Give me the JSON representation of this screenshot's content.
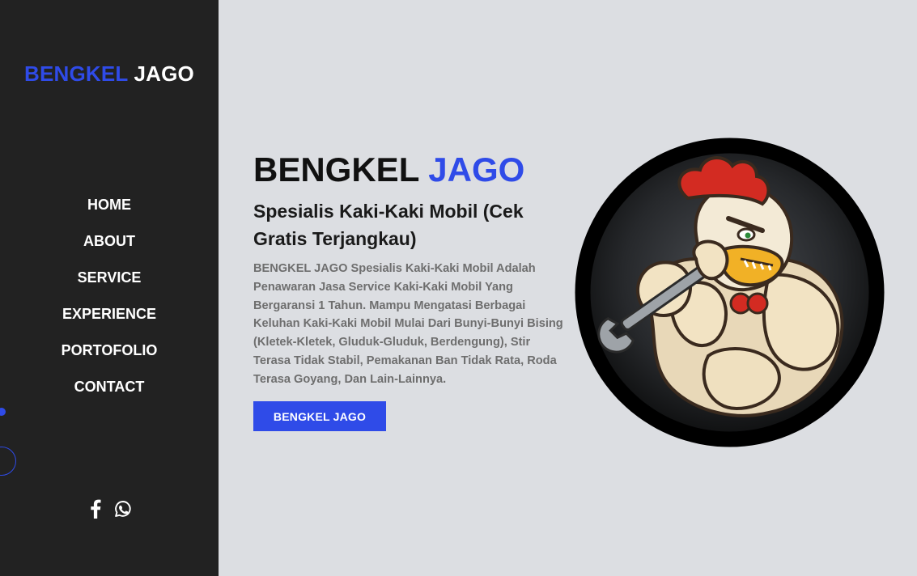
{
  "sidebar": {
    "logo": {
      "part1": "BENGKEL",
      "part2": "JAGO"
    },
    "nav": [
      {
        "label": "HOME"
      },
      {
        "label": "ABOUT"
      },
      {
        "label": "SERVICE"
      },
      {
        "label": "EXPERIENCE"
      },
      {
        "label": "PORTOFOLIO"
      },
      {
        "label": "CONTACT"
      }
    ],
    "social": [
      "facebook-icon",
      "whatsapp-icon"
    ]
  },
  "hero": {
    "title_part1": "BENGKEL",
    "title_part2": "JAGO",
    "subtitle": "Spesialis Kaki-Kaki Mobil (Cek Gratis Terjangkau)",
    "description": "BENGKEL JAGO Spesialis Kaki-Kaki Mobil Adalah Penawaran Jasa Service Kaki-Kaki Mobil Yang Bergaransi 1 Tahun. Mampu Mengatasi Berbagai Keluhan Kaki-Kaki Mobil Mulai Dari Bunyi-Bunyi Bising (Kletek-Kletek, Gluduk-Gluduk, Berdengung), Stir Terasa Tidak Stabil, Pemakanan Ban Tidak Rata, Roda Terasa Goyang, Dan Lain-Lainnya.",
    "cta_label": "BENGKEL JAGO"
  },
  "colors": {
    "accent": "#2f4be8",
    "sidebar_bg": "#222222",
    "page_bg": "#dcdee2"
  }
}
